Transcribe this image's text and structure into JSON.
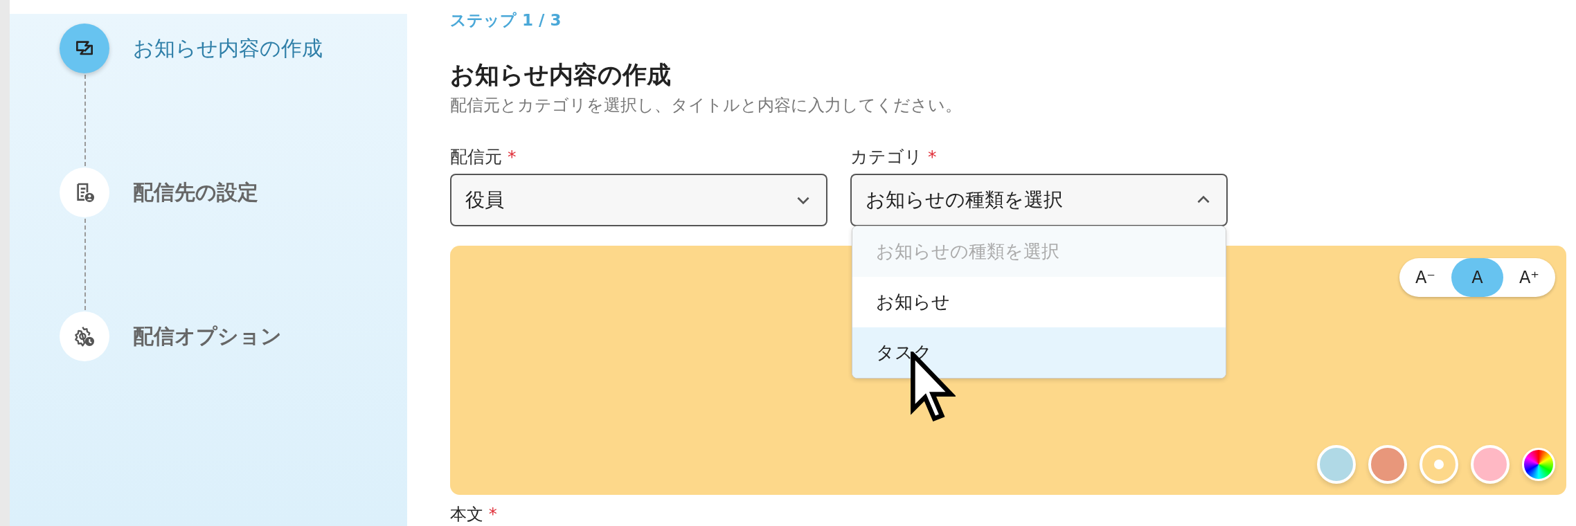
{
  "steps": [
    {
      "label": "お知らせ内容の作成",
      "selected": true,
      "kind": "compose"
    },
    {
      "label": "配信先の設定",
      "selected": false,
      "kind": "recipients"
    },
    {
      "label": "配信オプション",
      "selected": false,
      "kind": "options"
    }
  ],
  "step_indicator": "ステップ 1 / 3",
  "heading": "お知らせ内容の作成",
  "subtitle": "配信元とカテゴリを選択し、タイトルと内容に入力してください。",
  "fields": [
    {
      "label": "配信元",
      "required": "*",
      "value": "役員",
      "expanded": false
    },
    {
      "label": "カテゴリ",
      "required": "*",
      "value": "お知らせの種類を選択",
      "expanded": true,
      "options": [
        {
          "label": "お知らせの種類を選択",
          "kind": "placeholder",
          "highlighted": false
        },
        {
          "label": "お知らせ",
          "kind": "option",
          "highlighted": false
        },
        {
          "label": "タスク",
          "kind": "option",
          "highlighted": true
        }
      ]
    }
  ],
  "font_sizes": [
    {
      "label": "A⁻",
      "selected": false
    },
    {
      "label": "A",
      "selected": true
    },
    {
      "label": "A⁺",
      "selected": false
    }
  ],
  "swatches": [
    {
      "kind": "color",
      "color": "#b0d9e6",
      "selected": false
    },
    {
      "kind": "color",
      "color": "#e8977b",
      "selected": false
    },
    {
      "kind": "color",
      "color": "#fdd88a",
      "selected": true
    },
    {
      "kind": "color",
      "color": "#ffb8c4",
      "selected": false
    },
    {
      "kind": "picker",
      "selected": false
    }
  ],
  "body_label": {
    "label": "本文",
    "required": "*"
  }
}
